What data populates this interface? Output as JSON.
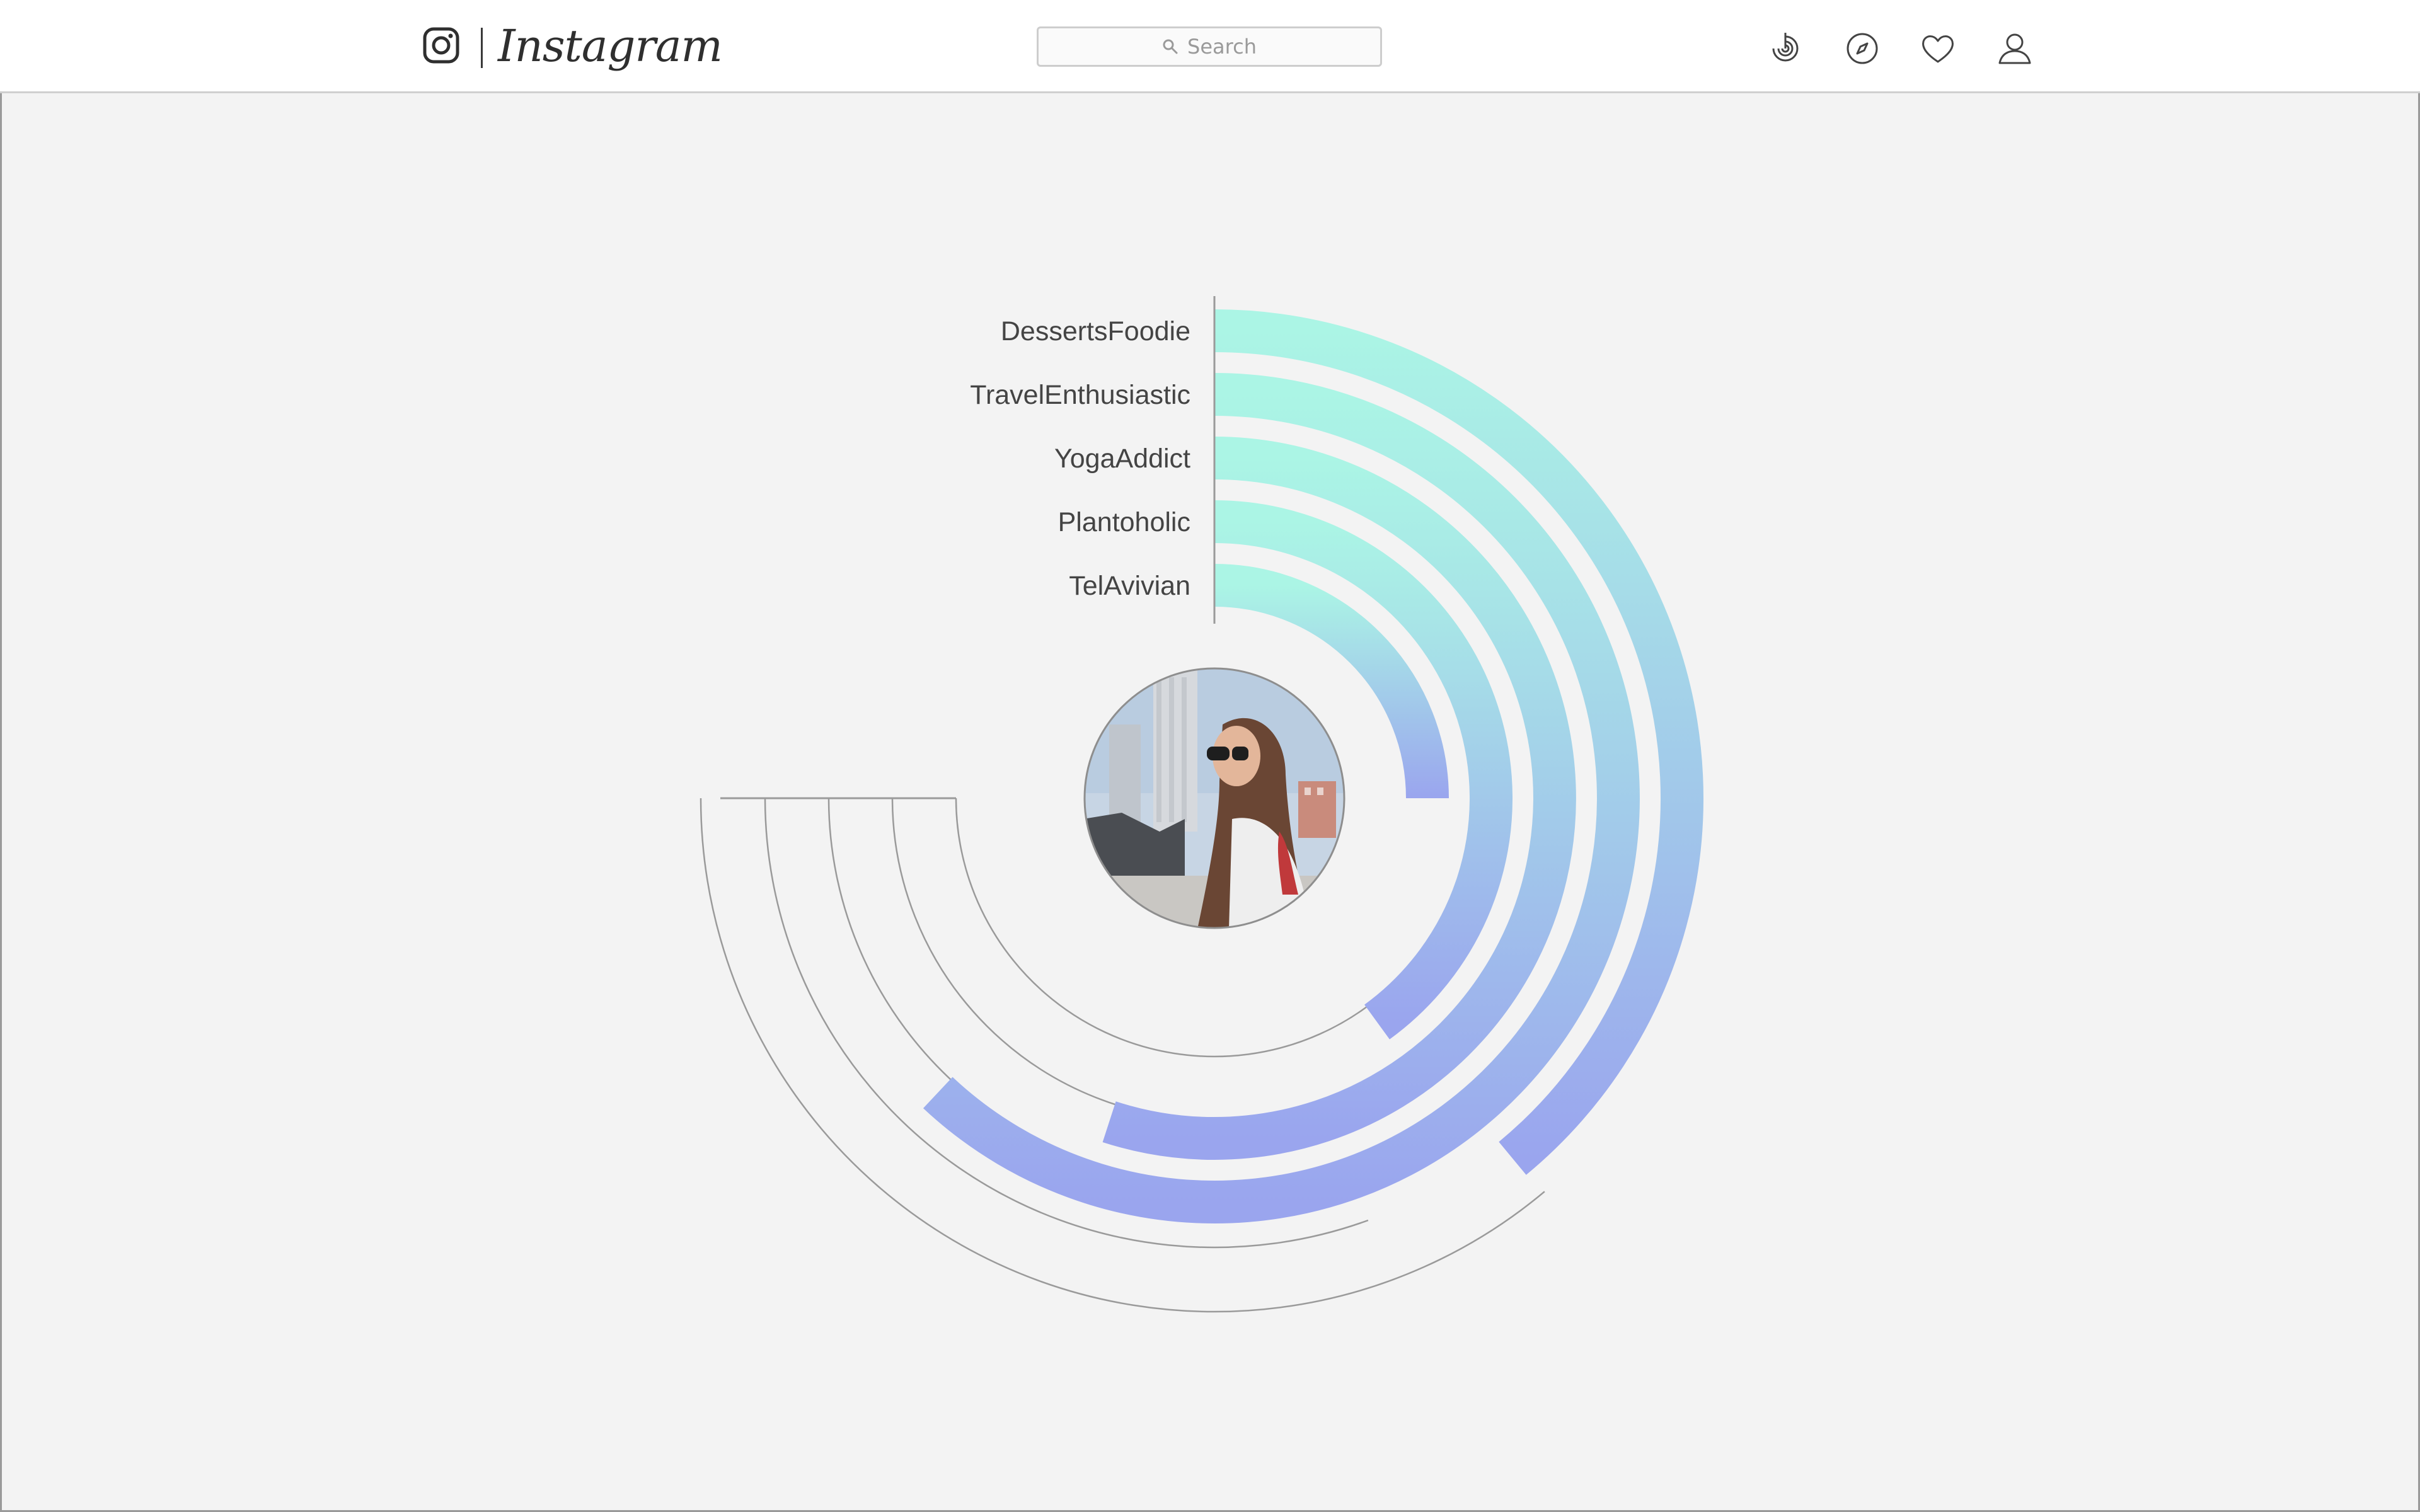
{
  "header": {
    "brand": "Instagram",
    "search": {
      "placeholder": "Search"
    },
    "icons": [
      "instagram-camera-icon",
      "activity-icon",
      "explore-compass-icon",
      "heart-icon",
      "profile-icon"
    ]
  },
  "colors": {
    "header_bg": "#ffffff",
    "page_bg": "#f3f3f3",
    "gradient_start": "#abf5e5",
    "gradient_end": "#9aa5ee",
    "guide_stroke": "#9a9a9a"
  },
  "chart_data": {
    "type": "radial-bar",
    "categories": [
      "DessertsFoodie",
      "TravelEnthusiastic",
      "YogaAddict",
      "Plantoholic",
      "TelAvivian"
    ],
    "values": [
      0.39,
      0.62,
      0.55,
      0.4,
      0.25
    ],
    "value_unit": "fraction of full circle, clockwise from top",
    "center_image": "profile photo of woman with sunglasses",
    "grid": false
  }
}
